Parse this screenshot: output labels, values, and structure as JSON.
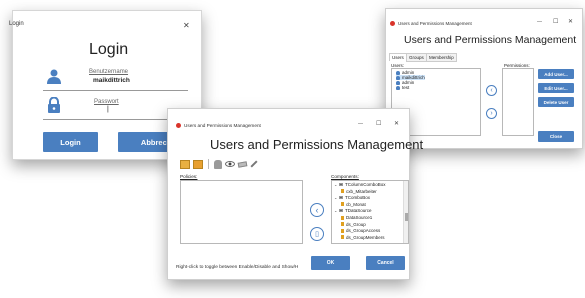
{
  "login": {
    "window_title": "Login",
    "heading": "Login",
    "username_label": "Benutzername",
    "username_value": "maikdittrich",
    "password_label": "Passwort",
    "password_value": "|",
    "login_button": "Login",
    "cancel_button": "Abbrechen",
    "close_glyph": "✕"
  },
  "users_window": {
    "window_title": "Users and Permissions Management",
    "heading": "Users and Permissions Management",
    "tabs": [
      {
        "label": "Users"
      },
      {
        "label": "Groups"
      },
      {
        "label": "Membership"
      }
    ],
    "users_label": "Users:",
    "permissions_label": "Permissions:",
    "users": [
      {
        "name": "admin"
      },
      {
        "name": "maikdittrich"
      },
      {
        "name": "admin"
      },
      {
        "name": "test"
      }
    ],
    "add_user": "Add User...",
    "edit_user": "Edit User...",
    "delete_user": "Delete User",
    "close_button": "Close",
    "minimize_glyph": "—",
    "maximize_glyph": "☐",
    "close_glyph": "✕"
  },
  "policies_window": {
    "window_title": "Users and Permissions Management",
    "heading": "Users and Permissions Management",
    "policies_label": "Policies:",
    "components_label": "Components:",
    "components": [
      {
        "label": "TColumnComboBox",
        "kind": "type",
        "level": 0
      },
      {
        "label": "cxb_Mitarbeiter",
        "kind": "prop",
        "level": 1
      },
      {
        "label": "TComboBox",
        "kind": "type",
        "level": 0
      },
      {
        "label": "cb_Monat",
        "kind": "prop",
        "level": 1
      },
      {
        "label": "TDataSource",
        "kind": "type",
        "level": 0
      },
      {
        "label": "DataSource1",
        "kind": "prop",
        "level": 1
      },
      {
        "label": "ds_Group",
        "kind": "prop",
        "level": 1
      },
      {
        "label": "ds_GroupAccess",
        "kind": "prop",
        "level": 1
      },
      {
        "label": "ds_GroupMembers",
        "kind": "prop",
        "level": 1
      }
    ],
    "hint": "Right-click to toggle between Enable/Disable and Show/H",
    "ok_button": "OK",
    "cancel_button": "Cancel",
    "minimize_glyph": "—",
    "maximize_glyph": "☐",
    "close_glyph": "✕"
  },
  "colors": {
    "accent": "#4a7fc0",
    "app_icon": "#d9342b"
  }
}
